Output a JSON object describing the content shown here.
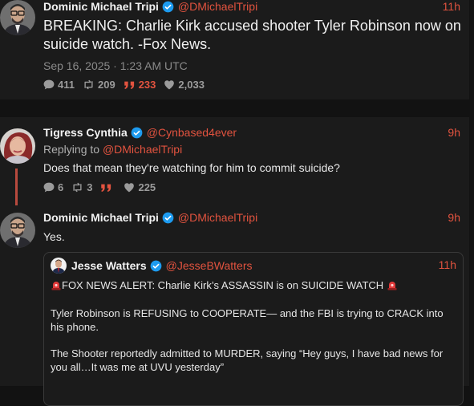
{
  "post1": {
    "author_name": "Dominic Michael Tripi",
    "author_handle": "@DMichaelTripi",
    "time": "11h",
    "text": "BREAKING: Charlie Kirk accused shooter Tyler Robinson now on suicide watch. -Fox News.",
    "timestamp": "Sep 16, 2025 · 1:23 AM UTC",
    "stats": {
      "replies": "411",
      "reposts": "209",
      "quotes": "233",
      "likes": "2,033"
    }
  },
  "post2": {
    "author_name": "Tigress Cynthia",
    "author_handle": "@Cynbased4ever",
    "time": "9h",
    "replying_prefix": "Replying to ",
    "replying_handle": "@DMichaelTripi",
    "text": "Does that mean they're watching for him to commit suicide?",
    "stats": {
      "replies": "6",
      "reposts": "3",
      "likes": "225"
    }
  },
  "post3": {
    "author_name": "Dominic Michael Tripi",
    "author_handle": "@DMichaelTripi",
    "time": "9h",
    "text": "Yes."
  },
  "quoted": {
    "author_name": "Jesse Watters",
    "author_handle": "@JesseBWatters",
    "time": "11h",
    "line1": "FOX NEWS ALERT: Charlie Kirk’s ASSASSIN is on SUICIDE WATCH",
    "para2": "Tyler Robinson is REFUSING to COOPERATE— and the FBI is trying to CRACK into his phone.",
    "para3": "The Shooter reportedly admitted to MURDER, saying “Hey guys, I have bad news for you all…It was me at UVU yesterday”"
  },
  "colors": {
    "accent": "#e2533f",
    "verified": "#1d9bf0",
    "background": "#121212",
    "card": "#1b1b1b"
  }
}
